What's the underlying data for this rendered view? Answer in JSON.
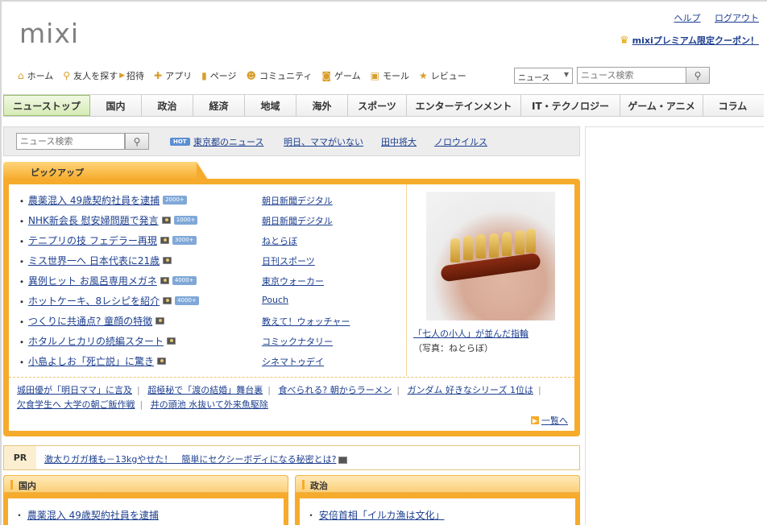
{
  "header": {
    "logo": "mixi",
    "help": "ヘルプ",
    "logout": "ログアウト",
    "coupon": "mixiプレミアム限定クーポン！"
  },
  "gnav": {
    "home": "ホーム",
    "find_friends": "友人を探す",
    "invite": "招待",
    "apps": "アプリ",
    "pages": "ページ",
    "community": "コミュニティ",
    "games": "ゲーム",
    "mall": "モール",
    "review": "レビュー",
    "select_value": "ニュース",
    "search_placeholder": "ニュース検索"
  },
  "tabs": [
    "ニューストップ",
    "国内",
    "政治",
    "経済",
    "地域",
    "海外",
    "スポーツ",
    "エンターテインメント",
    "IT・テクノロジー",
    "ゲーム・アニメ",
    "コラム"
  ],
  "search": {
    "placeholder": "ニュース検索",
    "hot": "HOT",
    "hot_links": [
      "東京都のニュース",
      "明日、ママがいない",
      "田中将大",
      "ノロウイルス"
    ]
  },
  "pickup": {
    "title": "ピックアップ",
    "items": [
      {
        "title": "農薬混入 49歳契約社員を逮捕",
        "count": "2000+",
        "source": "朝日新聞デジタル"
      },
      {
        "title": "NHK新会長 慰安婦問題で発言",
        "count": "1000+",
        "source": "朝日新聞デジタル"
      },
      {
        "title": "テニプリの技 フェデラー再現",
        "count": "3000+",
        "source": "ねとらぼ"
      },
      {
        "title": "ミス世界一へ 日本代表に21歳",
        "count": "",
        "source": "日刊スポーツ"
      },
      {
        "title": "異例ヒット お風呂専用メガネ",
        "count": "4000+",
        "source": "東京ウォーカー"
      },
      {
        "title": "ホットケーキ、8レシピを紹介",
        "count": "4000+",
        "source": "Pouch"
      },
      {
        "title": "つくりに共通点? 童顔の特徴",
        "count": "",
        "source": "教えて！ウォッチャー"
      },
      {
        "title": "ホタルノヒカリの続編スタート",
        "count": "",
        "source": "コミックナタリー"
      },
      {
        "title": "小島よしお「死亡説」に驚き",
        "count": "",
        "source": "シネマトゥデイ"
      }
    ],
    "photo_caption": "「七人の小人」が並んだ指輪",
    "photo_credit": "（写真：ねとらぼ）",
    "more_links_row1": [
      "城田優が「明日ママ」に言及",
      "超極秘で「渡の結婚」舞台裏",
      "食べられる? 朝からラーメン",
      "ガンダム 好きなシリーズ 1位は"
    ],
    "more_links_row2": [
      "欠食学生へ 大学の朝ご飯作戦",
      "井の頭池 水抜いて外来魚駆除"
    ],
    "all_link": "一覧へ"
  },
  "pr": {
    "label": "PR",
    "text": "激太りガガ様も－13kgやせた！　簡単にセクシーボディになる秘密とは?"
  },
  "boxes": [
    {
      "title": "国内",
      "headline": "農薬混入 49歳契約社員を逮捕"
    },
    {
      "title": "政治",
      "headline": "安倍首相「イルカ漁は文化」"
    }
  ],
  "colors": {
    "accent": "#f6ab2c",
    "link": "#1d3f8f",
    "active_tab": "#d6ebb7"
  }
}
